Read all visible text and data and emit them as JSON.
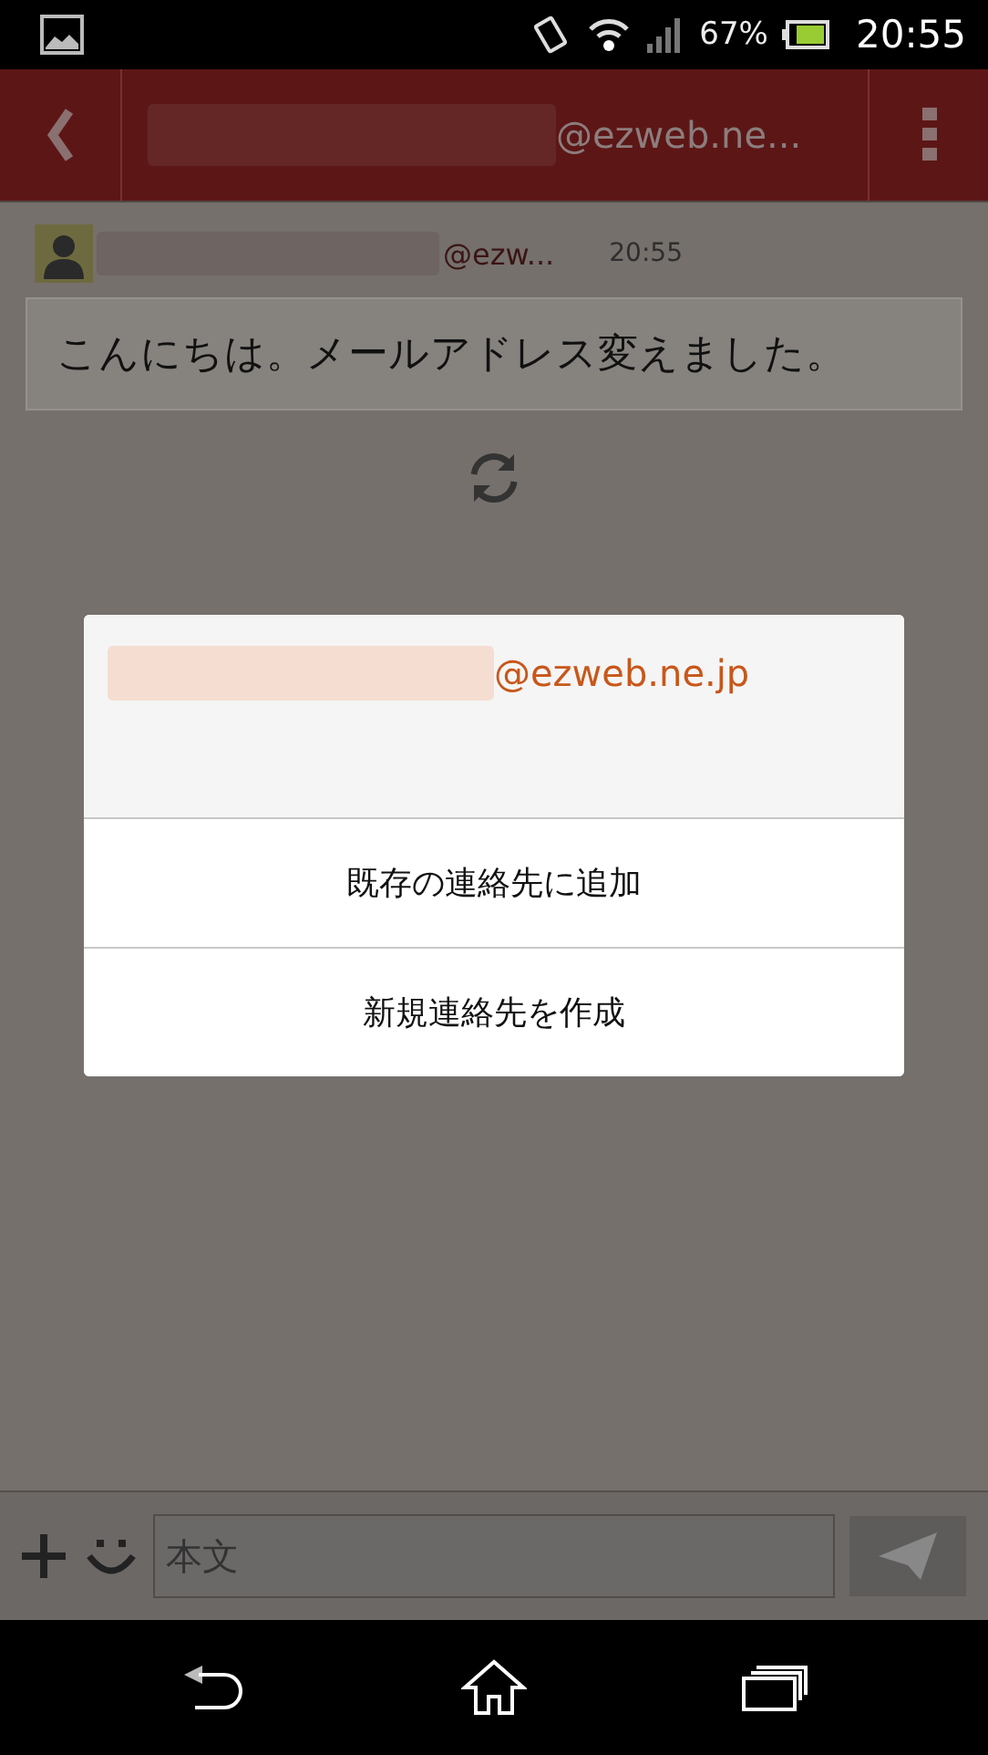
{
  "status_bar": {
    "battery": "67%",
    "time": "20:55"
  },
  "app_bar": {
    "title_suffix": "@ezweb.ne..."
  },
  "message": {
    "sender_suffix": "@ezw...",
    "time": "20:55",
    "body": "こんにちは。メールアドレス変えました。"
  },
  "dialog": {
    "title_suffix": "@ezweb.ne.jp",
    "options": [
      "既存の連絡先に追加",
      "新規連絡先を作成"
    ]
  },
  "composer": {
    "placeholder": "本文"
  }
}
